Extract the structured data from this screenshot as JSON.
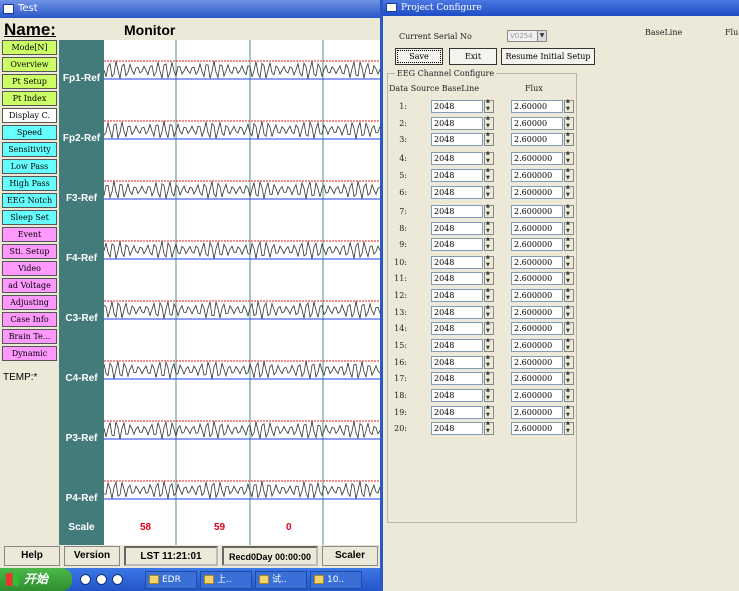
{
  "main_window": {
    "title": "Test",
    "name_label": "Name:",
    "monitor_label": "Monitor",
    "temp_label": "TEMP:*",
    "left_buttons": [
      {
        "label": "Mode[N]",
        "color": "green"
      },
      {
        "label": "Overview",
        "color": "green"
      },
      {
        "label": "Pt Setup",
        "color": "green"
      },
      {
        "label": "Pt Index",
        "color": "green"
      },
      {
        "label": "Display C.",
        "color": "white"
      },
      {
        "label": "Speed",
        "color": "cyan"
      },
      {
        "label": "Sensitivity",
        "color": "cyan"
      },
      {
        "label": "Low Pass",
        "color": "cyan"
      },
      {
        "label": "High Pass",
        "color": "cyan"
      },
      {
        "label": "EEG Notch",
        "color": "cyan"
      },
      {
        "label": "Sleep Set",
        "color": "cyan"
      },
      {
        "label": "Event",
        "color": "pink"
      },
      {
        "label": "Sti. Setup",
        "color": "pink"
      },
      {
        "label": "Video",
        "color": "pink"
      },
      {
        "label": "ad Voltage",
        "color": "pink"
      },
      {
        "label": "Adjusting",
        "color": "pink"
      },
      {
        "label": "Case Info",
        "color": "pink"
      },
      {
        "label": "Brain Te...",
        "color": "pink"
      },
      {
        "label": "Dynamic",
        "color": "pink"
      }
    ],
    "channels": [
      "Fp1-Ref",
      "Fp2-Ref",
      "F3-Ref",
      "F4-Ref",
      "C3-Ref",
      "C4-Ref",
      "P3-Ref",
      "P4-Ref"
    ],
    "scale_label": "Scale",
    "scale_values": [
      "58",
      "59",
      "0"
    ],
    "bottom": {
      "help": "Help",
      "version": "Version",
      "lst": "LST 11:21:01",
      "record": "Recd0Day 00:00:00",
      "scaler": "Scaler"
    }
  },
  "taskbar": {
    "start_label": "开始",
    "items": [
      "EDR",
      "上..",
      "试..",
      "10.."
    ]
  },
  "config_window": {
    "title": "Project Configure",
    "baseline_header": "BaseLine",
    "flu_header": "Flu",
    "serial_label": "Current Serial No",
    "serial_value": "V0254",
    "buttons": {
      "save": "Save",
      "exit": "Exit",
      "resume": "Resume Initial Setup"
    },
    "group_title": "EEG Channel Configure",
    "col_baseline": "Data Source BaseLine",
    "col_flux": "Flux",
    "rows": [
      {
        "num": "1:",
        "baseline": "2048",
        "flux": "2.60000"
      },
      {
        "num": "2:",
        "baseline": "2048",
        "flux": "2.60000"
      },
      {
        "num": "3:",
        "baseline": "2048",
        "flux": "2.60000"
      },
      {
        "num": "4:",
        "baseline": "2048",
        "flux": "2.600000"
      },
      {
        "num": "5:",
        "baseline": "2048",
        "flux": "2.600000"
      },
      {
        "num": "6:",
        "baseline": "2048",
        "flux": "2.600000"
      },
      {
        "num": "7:",
        "baseline": "2048",
        "flux": "2.600000"
      },
      {
        "num": "8:",
        "baseline": "2048",
        "flux": "2.600000"
      },
      {
        "num": "9:",
        "baseline": "2048",
        "flux": "2.600000"
      },
      {
        "num": "10:",
        "baseline": "2048",
        "flux": "2.600000"
      },
      {
        "num": "11:",
        "baseline": "2048",
        "flux": "2.600000"
      },
      {
        "num": "12:",
        "baseline": "2048",
        "flux": "2.600000"
      },
      {
        "num": "13:",
        "baseline": "2048",
        "flux": "2.600000"
      },
      {
        "num": "14:",
        "baseline": "2048",
        "flux": "2.600000"
      },
      {
        "num": "15:",
        "baseline": "2048",
        "flux": "2.600000"
      },
      {
        "num": "16:",
        "baseline": "2048",
        "flux": "2.600000"
      },
      {
        "num": "17:",
        "baseline": "2048",
        "flux": "2.600000"
      },
      {
        "num": "18:",
        "baseline": "2048",
        "flux": "2.600000"
      },
      {
        "num": "19:",
        "baseline": "2048",
        "flux": "2.600000"
      },
      {
        "num": "20:",
        "baseline": "2048",
        "flux": "2.600000"
      }
    ]
  }
}
